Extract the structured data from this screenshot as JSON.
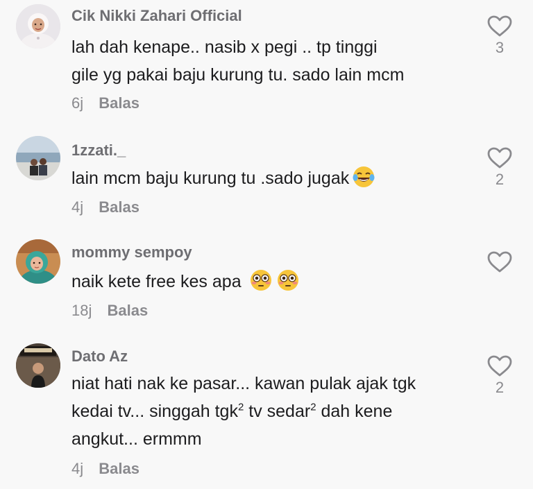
{
  "comments": [
    {
      "username": "Cik Nikki Zahari Official",
      "text": "lah dah kenape.. nasib x pegi .. tp tinggi\ngile yg pakai baju kurung tu. sado lain mcm",
      "time": "6j",
      "reply_label": "Balas",
      "likes": "3",
      "avatar_icon": "avatar-woman-hijab-white",
      "like_icon": "heart-outline-icon"
    },
    {
      "username": "1zzati._",
      "text": "lain mcm baju kurung tu .sado jugak",
      "emoji": [
        "face-with-tears-of-joy"
      ],
      "time": "4j",
      "reply_label": "Balas",
      "likes": "2",
      "avatar_icon": "avatar-couple-lake",
      "like_icon": "heart-outline-icon"
    },
    {
      "username": "mommy sempoy",
      "text": "naik kete free kes apa",
      "emoji": [
        "flushed-face",
        "flushed-face"
      ],
      "time": "18j",
      "reply_label": "Balas",
      "likes": "",
      "avatar_icon": "avatar-woman-hijab-teal",
      "like_icon": "heart-outline-icon"
    },
    {
      "username": "Dato Az",
      "text_parts": [
        "niat hati nak ke pasar... kawan pulak ajak tgk kedai tv... singgah tgk",
        "2",
        " tv sedar",
        "2",
        " dah kene angkut... ermmm"
      ],
      "time": "4j",
      "reply_label": "Balas",
      "likes": "2",
      "avatar_icon": "avatar-man-cafe",
      "like_icon": "heart-outline-icon"
    }
  ],
  "colors": {
    "background": "#f8f8f8",
    "username": "#6e6e72",
    "text": "#1c1c1e",
    "meta": "#8a8a8e"
  }
}
